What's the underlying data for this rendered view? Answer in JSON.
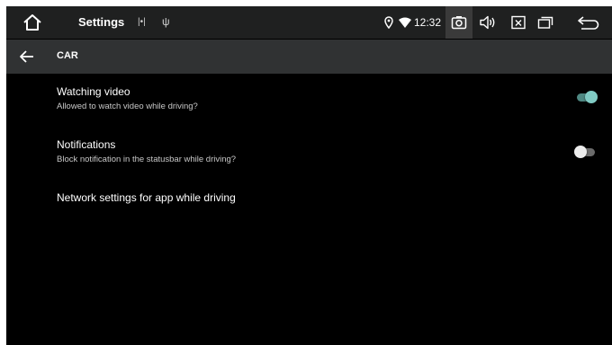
{
  "statusbar": {
    "app_title": "Settings",
    "usb_badge": "|•|",
    "usb_symbol": "ψ",
    "time": "12:32",
    "icons": [
      "home-icon",
      "location-icon",
      "wifi-icon",
      "camera-icon",
      "volume-icon",
      "close-box-icon",
      "recent-apps-icon",
      "back-icon"
    ]
  },
  "toolbar": {
    "title": "CAR",
    "back_icon": "arrow-left-icon"
  },
  "preferences": [
    {
      "title": "Watching video",
      "summary": "Allowed to watch video while driving?",
      "switch_on": true
    },
    {
      "title": "Notifications",
      "summary": "Block notification in the statusbar while driving?",
      "switch_on": false
    },
    {
      "title": "Network settings for app while driving"
    }
  ],
  "colors": {
    "accent": "#80cbc4",
    "accent_track": "#4f8983",
    "switch_off_thumb": "#ececec",
    "switch_off_track": "#6b6b6b",
    "toolbar_bg": "#303233",
    "statusbar_bg": "#1f2020"
  }
}
